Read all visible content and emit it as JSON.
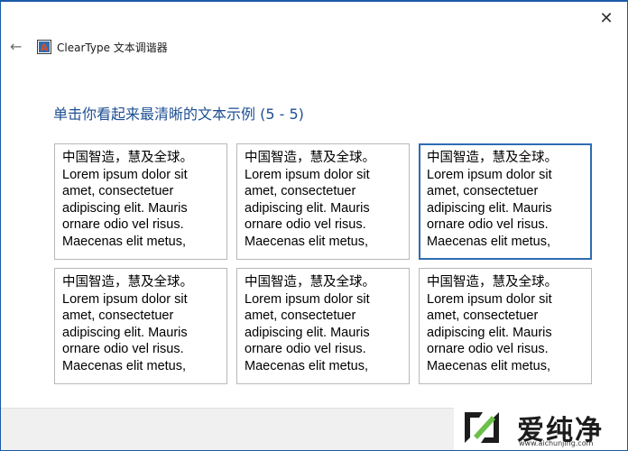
{
  "window": {
    "title": "ClearType 文本调谐器",
    "close_glyph": "✕",
    "back_glyph": "←"
  },
  "heading": "单击你看起来最清晰的文本示例 (5 - 5)",
  "samples": [
    {
      "text": "中国智造，慧及全球。\nLorem ipsum dolor sit\namet, consectetuer\nadipiscing elit. Mauris\nornare odio vel risus.\nMaecenas elit metus,",
      "selected": false
    },
    {
      "text": "中国智造，慧及全球。\nLorem ipsum dolor sit\namet, consectetuer\nadipiscing elit. Mauris\nornare odio vel risus.\nMaecenas elit metus,",
      "selected": false
    },
    {
      "text": "中国智造，慧及全球。\nLorem ipsum dolor sit\namet, consectetuer\nadipiscing elit. Mauris\nornare odio vel risus.\nMaecenas elit metus,",
      "selected": true
    },
    {
      "text": "中国智造，慧及全球。\nLorem ipsum dolor sit\namet, consectetuer\nadipiscing elit. Mauris\nornare odio vel risus.\nMaecenas elit metus,",
      "selected": false
    },
    {
      "text": "中国智造，慧及全球。\nLorem ipsum dolor sit\namet, consectetuer\nadipiscing elit. Mauris\nornare odio vel risus.\nMaecenas elit metus,",
      "selected": false
    },
    {
      "text": "中国智造，慧及全球。\nLorem ipsum dolor sit\namet, consectetuer\nadipiscing elit. Mauris\nornare odio vel risus.\nMaecenas elit metus,",
      "selected": false
    }
  ],
  "watermark": {
    "text": "爱纯净",
    "url": "www.aichunjing.com"
  },
  "colors": {
    "accent": "#2f6cb0",
    "heading": "#1d4f93",
    "window_border": "#1a5aa6"
  },
  "icons": {
    "close": "close-icon",
    "back": "back-arrow-icon",
    "app": "cleartype-app-icon",
    "watermark_logo": "aichunjing-logo-icon"
  }
}
